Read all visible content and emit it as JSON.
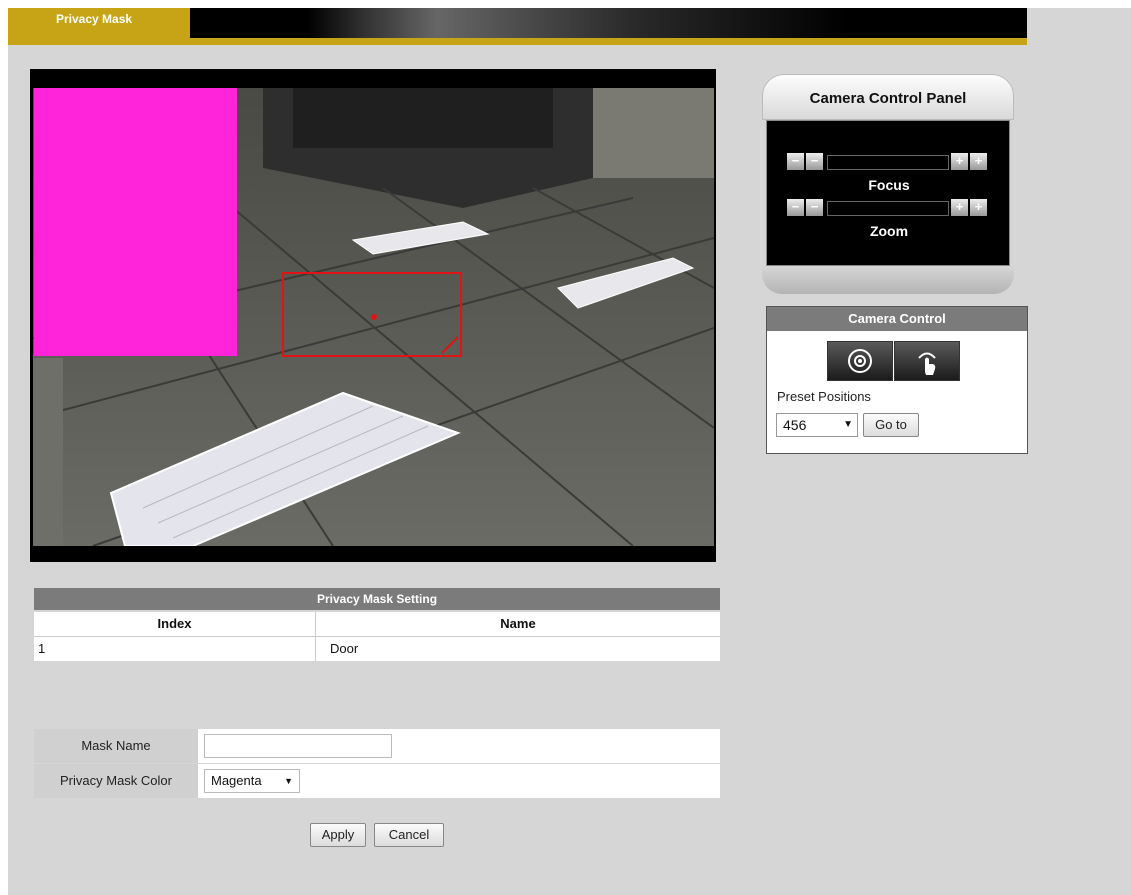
{
  "header": {
    "active_tab": "Privacy Mask"
  },
  "camera_control_panel": {
    "title": "Camera Control Panel",
    "focus_label": "Focus",
    "zoom_label": "Zoom",
    "minus": "−",
    "plus": "+"
  },
  "camera_control": {
    "title": "Camera Control",
    "preset_label": "Preset Positions",
    "preset_value": "456",
    "goto_label": "Go to"
  },
  "privacy_mask_table": {
    "title": "Privacy Mask Setting",
    "columns": [
      "Index",
      "Name"
    ],
    "rows": [
      {
        "index": "1",
        "name": "Door"
      }
    ]
  },
  "form": {
    "mask_name_label": "Mask Name",
    "mask_name_value": "",
    "color_label": "Privacy Mask Color",
    "color_value": "Magenta",
    "apply_label": "Apply",
    "cancel_label": "Cancel"
  },
  "colors": {
    "accent": "#c7a415",
    "mask": "#ff24d9",
    "selection": "#e01414",
    "header_gray": "#7b7b7b"
  }
}
